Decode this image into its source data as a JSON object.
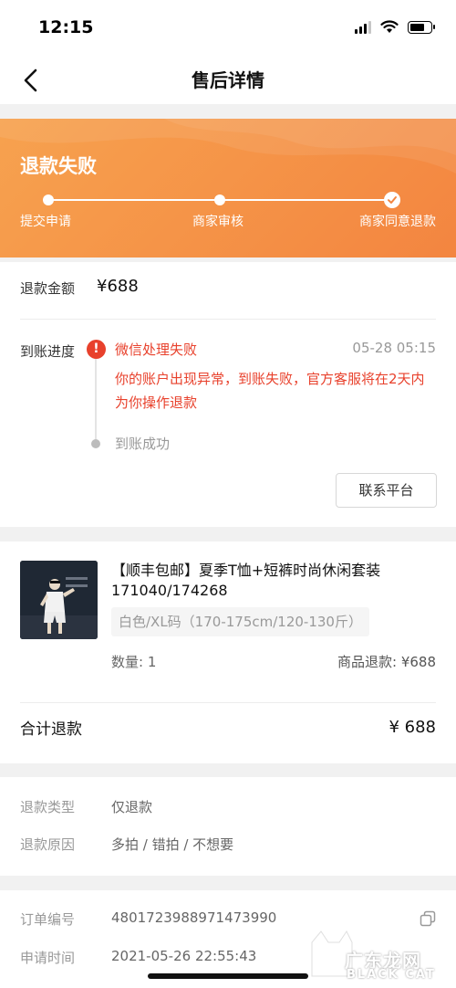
{
  "status_bar": {
    "time": "12:15",
    "battery_level": 0.75
  },
  "nav": {
    "title": "售后详情",
    "back_icon": "chevron-left-icon"
  },
  "banner": {
    "status": "退款失败",
    "steps": [
      {
        "label": "提交申请",
        "done": true
      },
      {
        "label": "商家审核",
        "done": true
      },
      {
        "label": "商家同意退款",
        "done": true,
        "current": true
      }
    ],
    "colors": {
      "start": "#f7a24f",
      "end": "#f38540"
    }
  },
  "refund": {
    "amount_label": "退款金额",
    "amount_value": "¥688",
    "progress_label": "到账进度",
    "timeline": {
      "failed_title": "微信处理失败",
      "failed_time": "05-28 05:15",
      "failed_desc": "你的账户出现异常，到账失败，官方客服将在2天内为你操作退款",
      "success_title": "到账成功"
    },
    "contact_button": "联系平台",
    "error_color": "#e8412c"
  },
  "product": {
    "title": "【顺丰包邮】夏季T恤+短裤时尚休闲套装171040/174268",
    "sku": "白色/XL码（170-175cm/120-130斤）",
    "quantity": "数量: 1",
    "item_refund": "商品退款: ¥688",
    "total_label": "合计退款",
    "total_value": "¥ 688"
  },
  "refund_info": {
    "type_label": "退款类型",
    "type_value": "仅退款",
    "reason_label": "退款原因",
    "reason_value": "多拍 / 错拍 / 不想要"
  },
  "order": {
    "number_label": "订单编号",
    "number_value": "4801723988971473990",
    "time_label": "申请时间",
    "time_value": "2021-05-26 22:55:43",
    "copy_icon": "copy-icon"
  },
  "watermark": {
    "cn": "广东龙网",
    "en": "BLACK CAT"
  }
}
